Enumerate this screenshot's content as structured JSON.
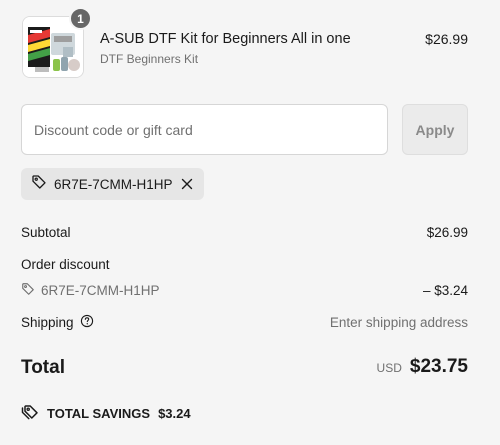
{
  "product": {
    "quantity": "1",
    "title": "A-SUB DTF Kit for Beginners All in one",
    "variant": "DTF Beginners Kit",
    "price": "$26.99",
    "thumb_icon": "product-thumbnail"
  },
  "discount": {
    "placeholder": "Discount code or gift card",
    "value": "",
    "apply_label": "Apply",
    "applied_code": "6R7E-7CMM-H1HP",
    "tag_icon": "tag-icon",
    "remove_icon": "close-icon"
  },
  "summary": {
    "subtotal_label": "Subtotal",
    "subtotal_value": "$26.99",
    "order_discount_label": "Order discount",
    "order_discount_code": "6R7E-7CMM-H1HP",
    "order_discount_value": "– $3.24",
    "shipping_label": "Shipping",
    "shipping_help_icon": "help-circle-icon",
    "shipping_value": "Enter shipping address",
    "total_label": "Total",
    "currency": "USD",
    "total_value": "$23.75",
    "savings_label": "TOTAL SAVINGS",
    "savings_value": "$3.24",
    "savings_icon": "tag-double-icon"
  },
  "colors": {
    "background": "#f5f5f5",
    "text": "#1a1a1a",
    "muted": "#707070",
    "badge": "#666666",
    "chip": "#e6e6e6",
    "apply_bg": "#ebebeb"
  }
}
